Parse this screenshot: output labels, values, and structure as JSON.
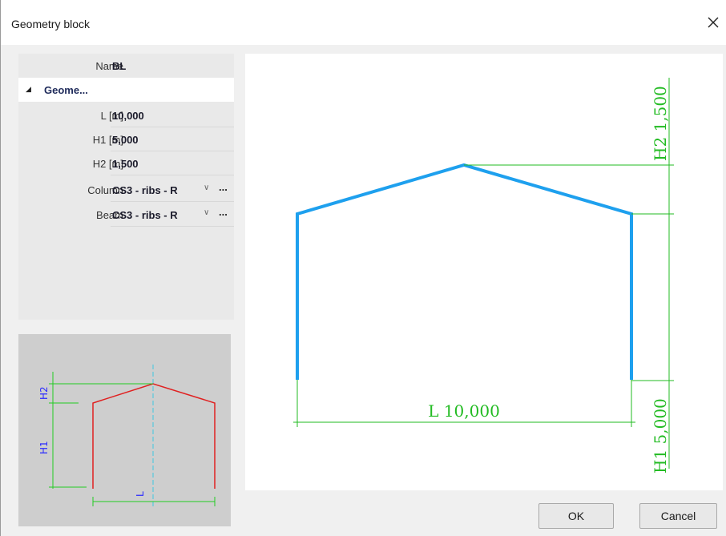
{
  "window": {
    "title": "Geometry block",
    "close_symbol": "✕"
  },
  "properties": {
    "name_label": "Name",
    "name_value": "BL",
    "group_label": "Geome...",
    "rows": [
      {
        "label": "L [m]",
        "value": "10,000"
      },
      {
        "label": "H1 [m]",
        "value": "5,000"
      },
      {
        "label": "H2 [m]",
        "value": "1,500"
      }
    ],
    "column_label": "Column",
    "column_value": "CS3 - ribs - R",
    "beam_label": "Beam",
    "beam_value": "CS3 - ribs - R",
    "dropdown_symbol": "∨",
    "ellipsis": "..."
  },
  "preview": {
    "h1": "H1",
    "h2": "H2",
    "l": "L"
  },
  "drawing": {
    "dim_l": "L 10,000",
    "dim_h1": "H1 5,000",
    "dim_h2": "H2 1,500"
  },
  "colors": {
    "frame": "#1ea0ee",
    "dimension": "#22bb22",
    "preview_frame": "#e02020",
    "preview_dim": "#22cc22",
    "preview_text": "#2a2aff",
    "axis": "#40c8e0"
  },
  "buttons": {
    "ok": "OK",
    "cancel": "Cancel"
  }
}
